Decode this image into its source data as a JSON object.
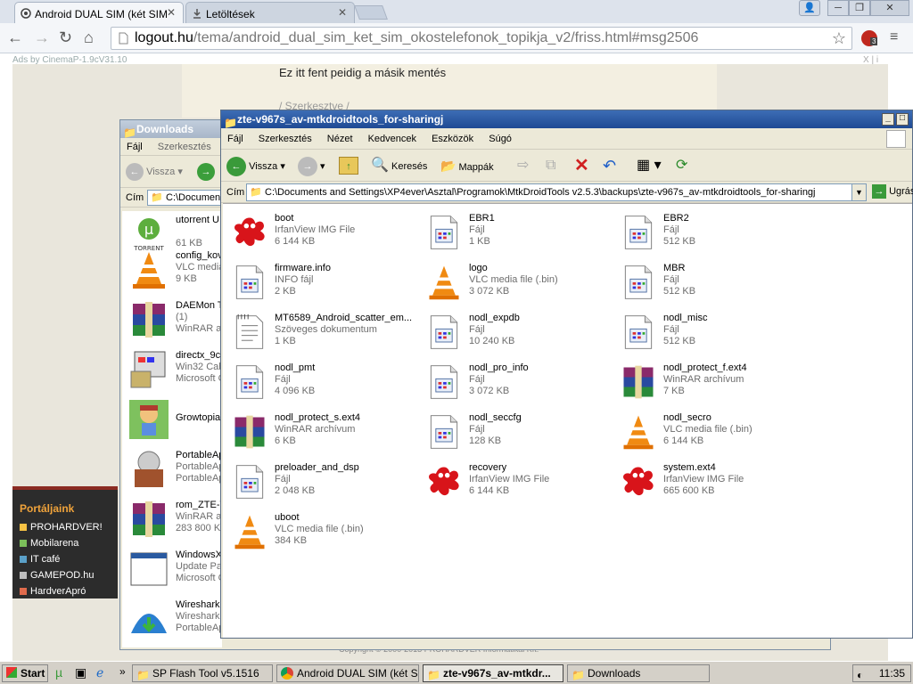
{
  "browser": {
    "tabs": [
      {
        "label": "Android DUAL SIM (két SIM",
        "close": "✕"
      },
      {
        "label": "Letöltések",
        "close": "✕"
      }
    ],
    "url_domain": "logout.hu",
    "url_path": "/tema/android_dual_sim_ket_sim_okostelefonok_topikja_v2/friss.html#msg2506",
    "ext_badge": "3",
    "page": {
      "ads_label": "Ads by CinemaP-1.9cV31.10",
      "ads_close": "X | i",
      "post_text": "Ez itt fent peidig a másik mentés",
      "post_text2": "/ Szerkesztve /",
      "portal_title": "Portáljaink",
      "portal_items": [
        {
          "label": "PROHARDVER!",
          "color": "#f6c244"
        },
        {
          "label": "Mobilarena",
          "color": "#7bbf5a"
        },
        {
          "label": "IT café",
          "color": "#5aa0c8"
        },
        {
          "label": "GAMEPOD.hu",
          "color": "#bfbfbf"
        },
        {
          "label": "HardverApró",
          "color": "#e06b4c"
        }
      ],
      "footer": "Copyright © 2000-2013 PROHARDVER Informatikai Kft."
    }
  },
  "downloads_window": {
    "title": "Downloads",
    "menu": [
      "Fájl",
      "Szerkesztés"
    ],
    "back_label": "Vissza",
    "address_label": "Cím",
    "address": "C:\\Documen",
    "items": [
      {
        "name": "utorrent U",
        "type": "",
        "size": "61 KB",
        "icon": "utorrent-icon"
      },
      {
        "name": "config_kov",
        "type": "VLC media",
        "size": "9 KB",
        "icon": "vlc-icon"
      },
      {
        "name": "DAEMon T",
        "type": "(1)",
        "size": "WinRAR ar",
        "icon": "winrar-icon"
      },
      {
        "name": "directx_9c",
        "type": "Win32 Cab",
        "size": "Microsoft C",
        "icon": "installer-icon"
      },
      {
        "name": "Growtopia",
        "type": "",
        "size": "",
        "icon": "growtopia-icon"
      },
      {
        "name": "PortableAp",
        "type": "PortableAp",
        "size": "PortableAp",
        "icon": "portableapps-icon"
      },
      {
        "name": "rom_ZTE-V",
        "type": "WinRAR ar",
        "size": "283 800 KI",
        "icon": "winrar-icon"
      },
      {
        "name": "WindowsX",
        "type": "Update Pa",
        "size": "Microsoft C",
        "icon": "window-icon"
      },
      {
        "name": "Wireshark",
        "type": "Wireshark",
        "size": "PortableAp",
        "icon": "wireshark-icon"
      }
    ]
  },
  "explorer_window": {
    "title": "zte-v967s_av-mtkdroidtools_for-sharingj",
    "menu": [
      "Fájl",
      "Szerkesztés",
      "Nézet",
      "Kedvencek",
      "Eszközök",
      "Súgó"
    ],
    "toolbar": {
      "back": "Vissza",
      "search": "Keresés",
      "folders": "Mappák"
    },
    "address_label": "Cím",
    "address": "C:\\Documents and Settings\\XP4ever\\Asztal\\Programok\\MtkDroidTools v2.5.3\\backups\\zte-v967s_av-mtkdroidtools_for-sharingj",
    "go_label": "Ugrás",
    "files": [
      {
        "name": "boot",
        "type": "IrfanView IMG File",
        "size": "6 144 KB",
        "icon": "irfanview-icon"
      },
      {
        "name": "EBR1",
        "type": "Fájl",
        "size": "1 KB",
        "icon": "file-icon"
      },
      {
        "name": "EBR2",
        "type": "Fájl",
        "size": "512 KB",
        "icon": "file-icon"
      },
      {
        "name": "firmware.info",
        "type": "INFO fájl",
        "size": "2 KB",
        "icon": "file-icon"
      },
      {
        "name": "logo",
        "type": "VLC media file (.bin)",
        "size": "3 072 KB",
        "icon": "vlc-icon"
      },
      {
        "name": "MBR",
        "type": "Fájl",
        "size": "512 KB",
        "icon": "file-icon"
      },
      {
        "name": "MT6589_Android_scatter_em...",
        "type": "Szöveges dokumentum",
        "size": "1 KB",
        "icon": "text-document-icon"
      },
      {
        "name": "nodl_expdb",
        "type": "Fájl",
        "size": "10 240 KB",
        "icon": "file-icon"
      },
      {
        "name": "nodl_misc",
        "type": "Fájl",
        "size": "512 KB",
        "icon": "file-icon"
      },
      {
        "name": "nodl_pmt",
        "type": "Fájl",
        "size": "4 096 KB",
        "icon": "file-icon"
      },
      {
        "name": "nodl_pro_info",
        "type": "Fájl",
        "size": "3 072 KB",
        "icon": "file-icon"
      },
      {
        "name": "nodl_protect_f.ext4",
        "type": "WinRAR archívum",
        "size": "7 KB",
        "icon": "winrar-icon"
      },
      {
        "name": "nodl_protect_s.ext4",
        "type": "WinRAR archívum",
        "size": "6 KB",
        "icon": "winrar-icon"
      },
      {
        "name": "nodl_seccfg",
        "type": "Fájl",
        "size": "128 KB",
        "icon": "file-icon"
      },
      {
        "name": "nodl_secro",
        "type": "VLC media file (.bin)",
        "size": "6 144 KB",
        "icon": "vlc-icon"
      },
      {
        "name": "preloader_and_dsp",
        "type": "Fájl",
        "size": "2 048 KB",
        "icon": "file-icon"
      },
      {
        "name": "recovery",
        "type": "IrfanView IMG File",
        "size": "6 144 KB",
        "icon": "irfanview-icon"
      },
      {
        "name": "system.ext4",
        "type": "IrfanView IMG File",
        "size": "665 600 KB",
        "icon": "irfanview-icon"
      },
      {
        "name": "uboot",
        "type": "VLC media file (.bin)",
        "size": "384 KB",
        "icon": "vlc-icon"
      }
    ]
  },
  "taskbar": {
    "start": "Start",
    "tasks": [
      {
        "label": "SP Flash Tool v5.1516",
        "active": false
      },
      {
        "label": "Android DUAL SIM (két S...",
        "active": false
      },
      {
        "label": "zte-v967s_av-mtkdr...",
        "active": true
      },
      {
        "label": "Downloads",
        "active": false
      }
    ],
    "clock": "11:35"
  }
}
